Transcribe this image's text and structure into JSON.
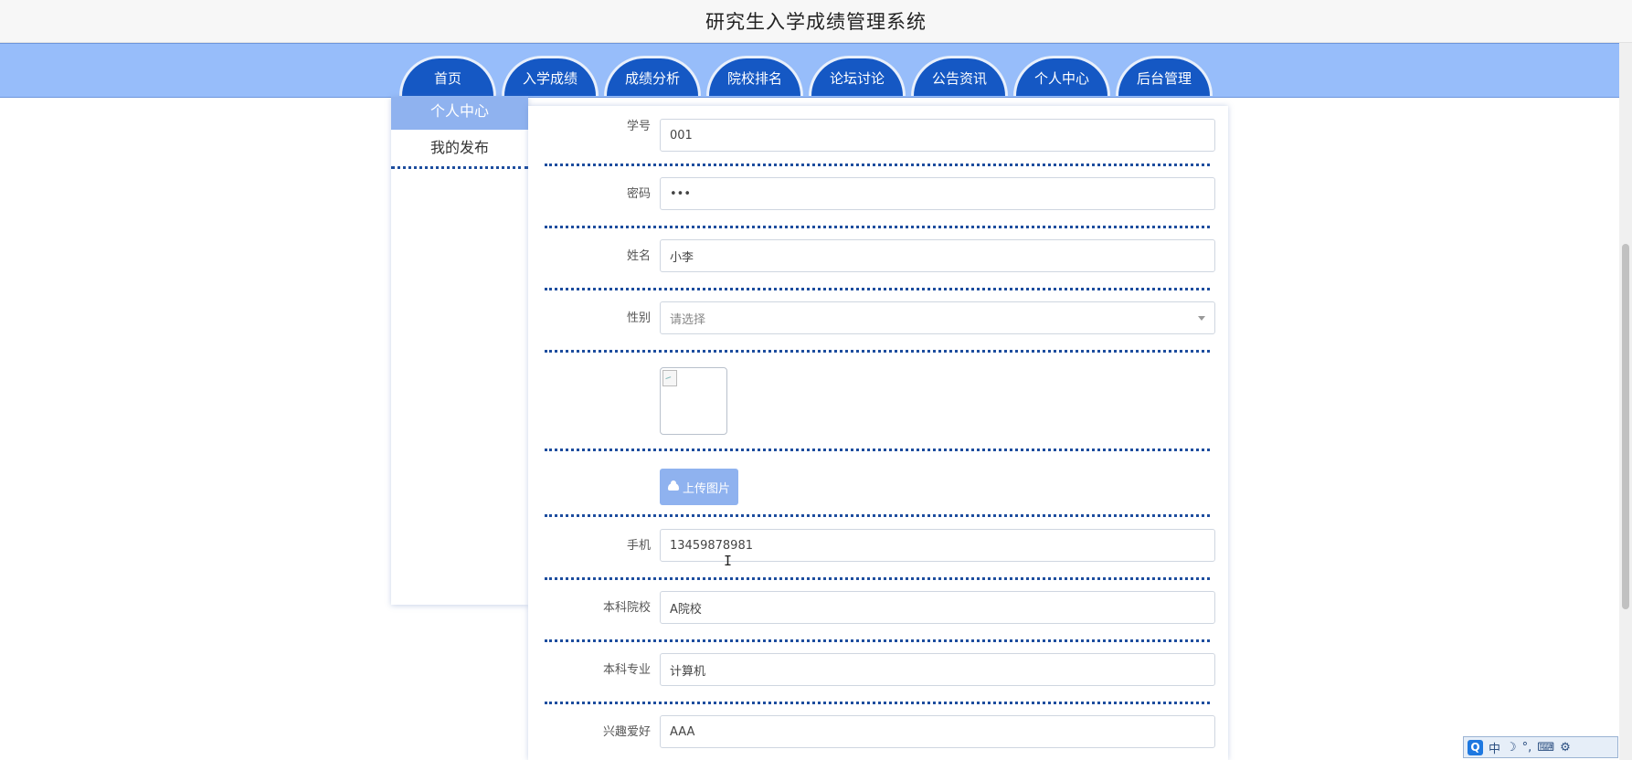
{
  "site_title": "研究生入学成绩管理系统",
  "nav": {
    "items": [
      {
        "label": "首页"
      },
      {
        "label": "入学成绩"
      },
      {
        "label": "成绩分析"
      },
      {
        "label": "院校排名"
      },
      {
        "label": "论坛讨论"
      },
      {
        "label": "公告资讯"
      },
      {
        "label": "个人中心"
      },
      {
        "label": "后台管理"
      }
    ]
  },
  "sidebar": {
    "active": "个人中心",
    "items": [
      {
        "label": "我的发布"
      }
    ]
  },
  "form": {
    "student_id": {
      "label": "学号",
      "value": "001"
    },
    "password": {
      "label": "密码",
      "value": "•••"
    },
    "name": {
      "label": "姓名",
      "value": "小李"
    },
    "gender": {
      "label": "性别",
      "placeholder": "请选择"
    },
    "upload_label": "上传图片",
    "phone": {
      "label": "手机",
      "value": "13459878981"
    },
    "undergrad_school": {
      "label": "本科院校",
      "value": "A院校"
    },
    "undergrad_major": {
      "label": "本科专业",
      "value": "计算机"
    },
    "hobby": {
      "label": "兴趣爱好",
      "value": "AAA"
    }
  },
  "tray": {
    "logo": "Q",
    "ime": "中",
    "items": [
      "☽",
      "°,",
      "⌨",
      "⚙"
    ]
  },
  "colors": {
    "nav_bg": "#97bdfa",
    "tab_bg": "#1558c4",
    "accent_light": "#8fb2ef",
    "divider": "#1d4d9e"
  }
}
